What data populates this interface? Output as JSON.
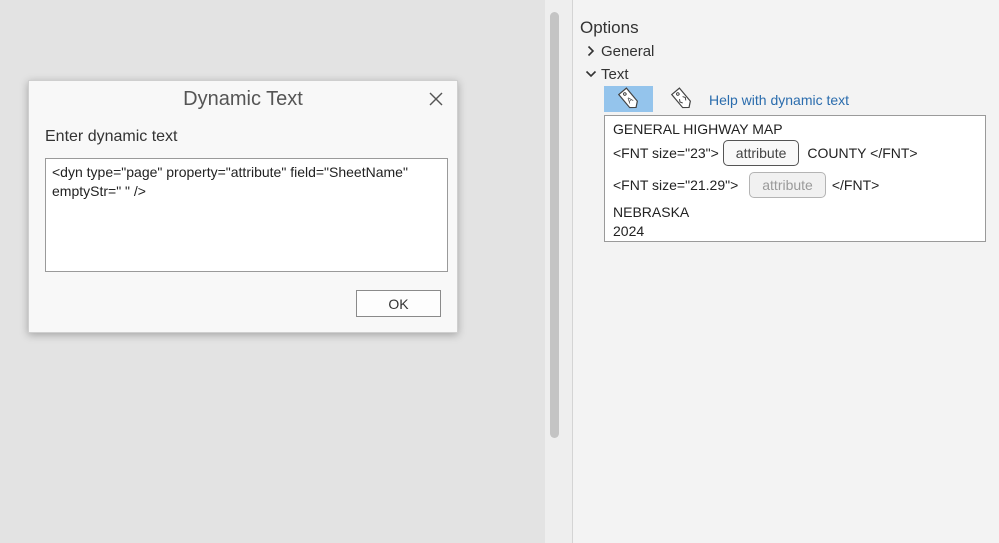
{
  "dialog": {
    "title": "Dynamic Text",
    "label": "Enter dynamic text",
    "text_value": "<dyn type=\"page\" property=\"attribute\" field=\"SheetName\" emptyStr=\" \" />",
    "ok_label": "OK"
  },
  "options": {
    "title": "Options",
    "general_label": "General",
    "text_label": "Text",
    "help_link": "Help with dynamic text",
    "editor": {
      "line1": "GENERAL HIGHWAY MAP",
      "line2_prefix": "<FNT size=\"23\">",
      "line2_tag": "attribute",
      "line2_suffix": "COUNTY </FNT>",
      "line3_prefix": "<FNT size=\"21.29\">",
      "line3_tag": "attribute",
      "line3_suffix": "</FNT>",
      "line4": "NEBRASKA",
      "line5": "2024"
    }
  },
  "icons": {
    "close": "close-icon",
    "chevron_right": "chevron-right-icon",
    "chevron_down": "chevron-down-icon",
    "tag_text": "tag-text-icon",
    "tag_code": "tag-code-icon"
  },
  "colors": {
    "active_button": "#94c4ec",
    "link": "#2a6cad"
  }
}
